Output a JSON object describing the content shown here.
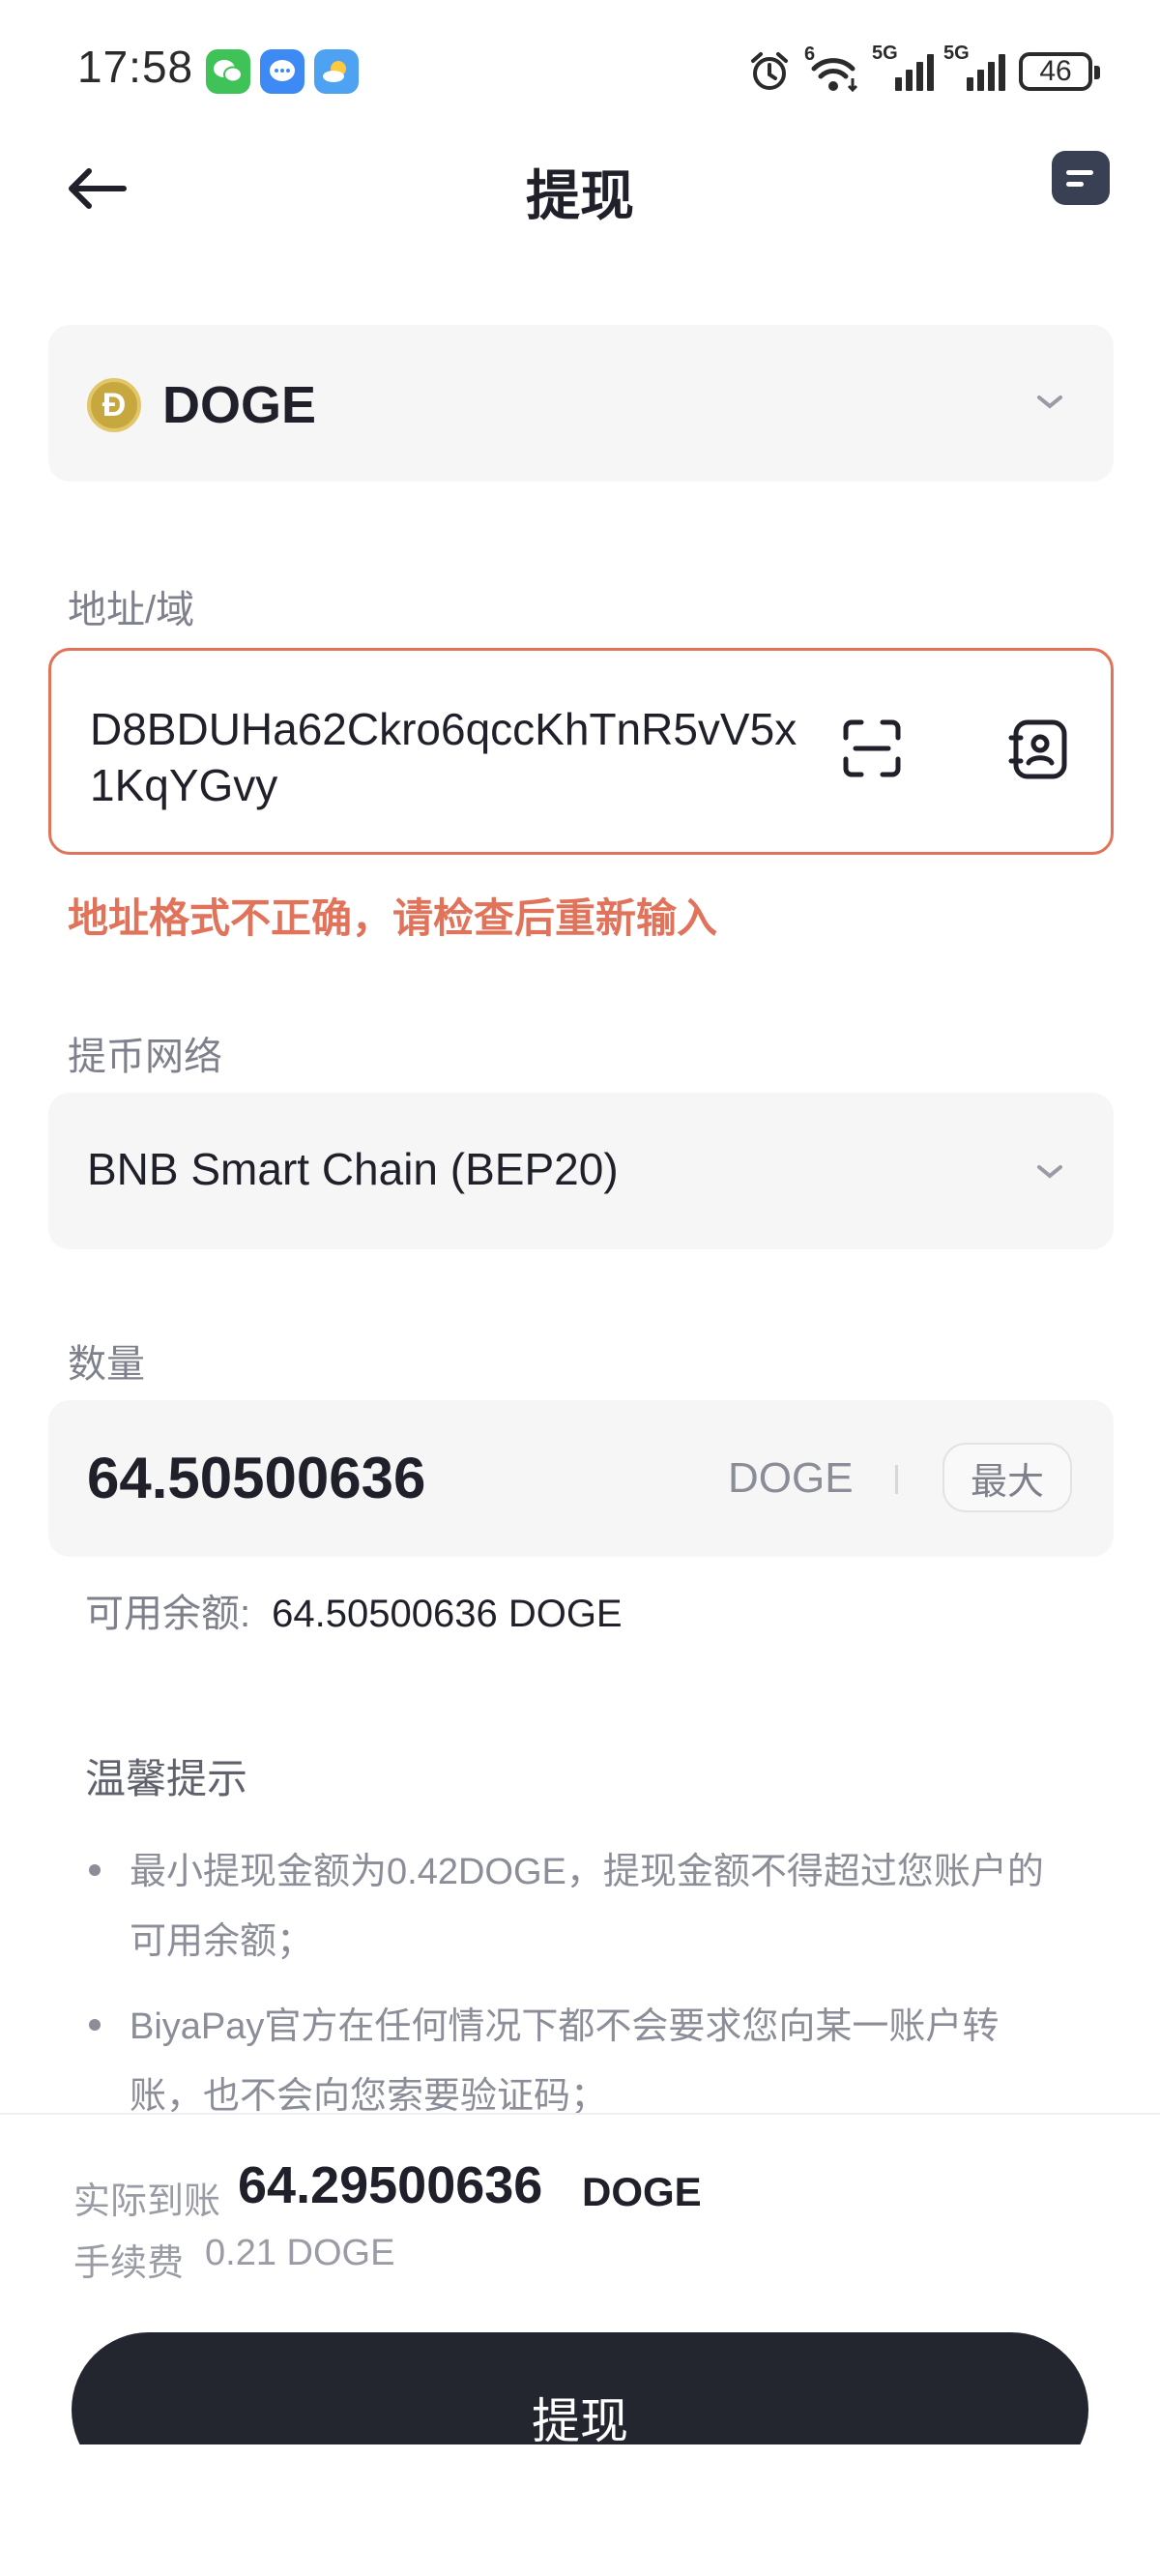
{
  "status_bar": {
    "time": "17:58",
    "apps": [
      "wechat-icon",
      "message-icon",
      "weather-icon"
    ],
    "alarm_icon": "alarm-clock-icon",
    "wifi_icon": "wifi-6-icon",
    "wifi_tag": "6",
    "signal1_tag": "5G",
    "signal2_tag": "5G",
    "battery": "46"
  },
  "header": {
    "title": "提现",
    "back_icon": "arrow-left-icon",
    "records_icon": "records-icon"
  },
  "coin": {
    "name": "DOGE",
    "logo_letter": "Ð"
  },
  "address": {
    "label": "地址/域",
    "value": "D8BDUHa62Ckro6qccKhTnR5vV5x1KqYGvy",
    "error": "地址格式不正确，请检查后重新输入",
    "error_color": "#e1735a"
  },
  "network": {
    "label": "提币网络",
    "value": "BNB Smart Chain (BEP20)"
  },
  "amount": {
    "label": "数量",
    "value": "64.50500636",
    "unit": "DOGE",
    "max_label": "最大",
    "available_label": "可用余额:",
    "available_value": "64.50500636 DOGE"
  },
  "tips": {
    "title": "温馨提示",
    "items": [
      "最小提现金额为0.42DOGE，提现金额不得超过您账户的可用余额；",
      "BiyaPay官方在任何情况下都不会要求您向某一账户转账，也不会向您索要验证码；"
    ]
  },
  "footer": {
    "actual_label": "实际到账",
    "actual_value": "64.29500636",
    "actual_unit": "DOGE",
    "fee_label": "手续费",
    "fee_value": "0.21 DOGE",
    "submit_label": "提现",
    "button_color": "#23252f"
  }
}
